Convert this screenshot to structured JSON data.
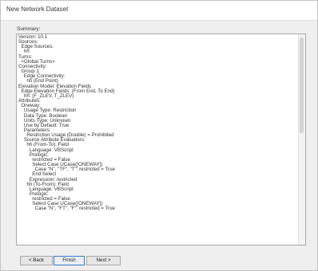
{
  "window": {
    "title": "New Network Dataset"
  },
  "summary": {
    "label": "Summary:",
    "lines": [
      "Version: 10.1",
      "",
      "Sources:",
      "  Edge Sources:",
      "    hh",
      "",
      "Turns:",
      "  <Global Turns>",
      "",
      "Connectivity:",
      "  Group 1:",
      "    Edge Connectivity:",
      "      hh (End Point)",
      "",
      "Elevation Model: Elevation Fields",
      "  Edge Elevation Fields: (From End, To End)",
      "    hh: (F_ZLEV, T_ZLEV)",
      "",
      "Attributes:",
      "  Oneway:",
      "    Usage Type: Restriction",
      "    Data Type: Boolean",
      "    Units Type: Unknown",
      "    Use by Default: True",
      "    Parameters:",
      "      Restriction Usage (Double) = Prohibited",
      "    Source Attribute Evaluators:",
      "      hh (From-To): Field",
      "        Language: VBScript",
      "        Prelogic:",
      "          restricted = False",
      "          Select Case UCase([ONEWAY])",
      "            Case \"N\", \"TF\", \"T\": restricted = True",
      "          End Select",
      "        Expression: restricted",
      "      hh (To-From): Field",
      "        Language: VBScript",
      "        Prelogic:",
      "          restricted = False",
      "          Select Case UCase([ONEWAY])",
      "            Case \"N\", \"FT\", \"F\": restricted = True"
    ]
  },
  "buttons": {
    "back": "< Back",
    "finish": "Finish",
    "next": "Next >"
  }
}
